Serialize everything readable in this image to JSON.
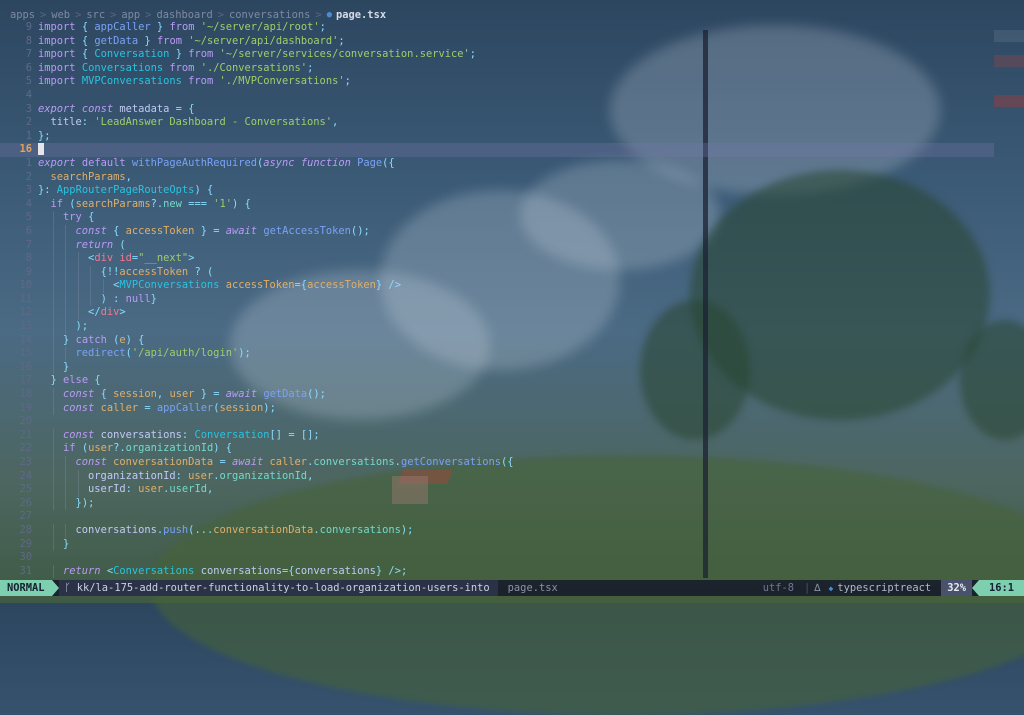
{
  "breadcrumb": {
    "parts": [
      "apps",
      "web",
      "src",
      "app",
      "dashboard",
      "conversations"
    ],
    "file": "page.tsx",
    "separator": ">"
  },
  "editor": {
    "lines": [
      {
        "n": "9",
        "text": "import { appCaller } from '~/server/api/root';"
      },
      {
        "n": "8",
        "text": "import { getData } from '~/server/api/dashboard';"
      },
      {
        "n": "7",
        "text": "import { Conversation } from '~/server/services/conversation.service';"
      },
      {
        "n": "6",
        "text": "import Conversations from './Conversations';"
      },
      {
        "n": "5",
        "text": "import MVPConversations from './MVPConversations';"
      },
      {
        "n": "4",
        "text": ""
      },
      {
        "n": "3",
        "text": "export const metadata = {"
      },
      {
        "n": "2",
        "text": "  title: 'LeadAnswer Dashboard - Conversations',"
      },
      {
        "n": "1",
        "text": "};"
      },
      {
        "n": "16",
        "text": ""
      },
      {
        "n": "1",
        "text": "export default withPageAuthRequired(async function Page({"
      },
      {
        "n": "2",
        "text": "  searchParams,"
      },
      {
        "n": "3",
        "text": "}: AppRouterPageRouteOpts) {"
      },
      {
        "n": "4",
        "text": "  if (searchParams?.new === '1') {"
      },
      {
        "n": "5",
        "text": "    try {"
      },
      {
        "n": "6",
        "text": "      const { accessToken } = await getAccessToken();"
      },
      {
        "n": "7",
        "text": "      return ("
      },
      {
        "n": "8",
        "text": "        <div id=\"__next\">"
      },
      {
        "n": "9",
        "text": "          {!!accessToken ? ("
      },
      {
        "n": "10",
        "text": "            <MVPConversations accessToken={accessToken} />"
      },
      {
        "n": "11",
        "text": "          ) : null}"
      },
      {
        "n": "12",
        "text": "        </div>"
      },
      {
        "n": "13",
        "text": "      );"
      },
      {
        "n": "14",
        "text": "    } catch (e) {"
      },
      {
        "n": "15",
        "text": "      redirect('/api/auth/login');"
      },
      {
        "n": "16",
        "text": "    }"
      },
      {
        "n": "17",
        "text": "  } else {"
      },
      {
        "n": "18",
        "text": "    const { session, user } = await getData();"
      },
      {
        "n": "19",
        "text": "    const caller = appCaller(session);"
      },
      {
        "n": "20",
        "text": ""
      },
      {
        "n": "21",
        "text": "    const conversations: Conversation[] = [];"
      },
      {
        "n": "22",
        "text": "    if (user?.organizationId) {"
      },
      {
        "n": "23",
        "text": "      const conversationData = await caller.conversations.getConversations({"
      },
      {
        "n": "24",
        "text": "        organizationId: user.organizationId,"
      },
      {
        "n": "25",
        "text": "        userId: user.userId,"
      },
      {
        "n": "26",
        "text": "      });"
      },
      {
        "n": "27",
        "text": ""
      },
      {
        "n": "28",
        "text": "      conversations.push(...conversationData.conversations);"
      },
      {
        "n": "29",
        "text": "    }"
      },
      {
        "n": "30",
        "text": ""
      },
      {
        "n": "31",
        "text": "    return <Conversations conversations={conversations} />;"
      }
    ]
  },
  "statusline": {
    "mode": "NORMAL",
    "branch": "kk/la-175-add-router-functionality-to-load-organization-users-into",
    "file": "page.tsx",
    "encoding": "utf-8",
    "divider": "|",
    "filetype": "typescriptreact",
    "percent": "32%",
    "position": "16:1"
  },
  "colors": {
    "mode_bg": "#7dcfb0",
    "cursor_line_number": "#e5a15a",
    "keyword": "#bb9af7",
    "function": "#7aa2f7",
    "string": "#9ece6a",
    "type": "#2ac3de"
  },
  "icons": {
    "file_type": "typescript-file-icon",
    "branch": "git-branch-icon",
    "os": "linux-icon",
    "language": "typescriptreact-icon"
  }
}
